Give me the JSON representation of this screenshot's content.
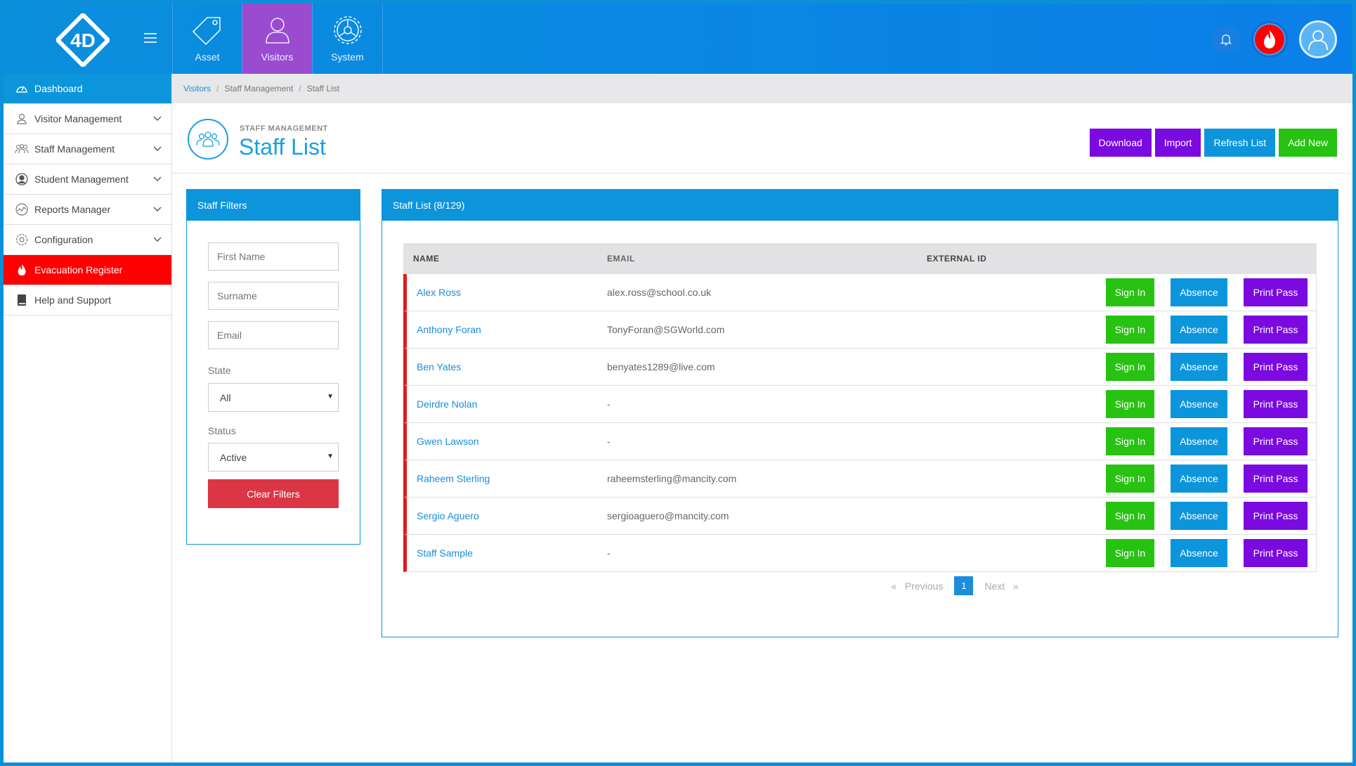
{
  "topbar": {
    "modules": [
      {
        "label": "Asset",
        "icon": "tag-icon"
      },
      {
        "label": "Visitors",
        "icon": "user-icon"
      },
      {
        "label": "System",
        "icon": "gear-icon"
      }
    ],
    "active_module": "Visitors"
  },
  "sidebar": {
    "items": [
      {
        "label": "Dashboard"
      },
      {
        "label": "Visitor Management"
      },
      {
        "label": "Staff Management"
      },
      {
        "label": "Student Management"
      },
      {
        "label": "Reports Manager"
      },
      {
        "label": "Configuration"
      },
      {
        "label": "Evacuation Register"
      },
      {
        "label": "Help and Support"
      }
    ]
  },
  "breadcrumb": {
    "items": [
      "Visitors",
      "Staff Management",
      "Staff List"
    ],
    "separator": "/"
  },
  "header": {
    "kicker": "STAFF MANAGEMENT",
    "title": "Staff List",
    "actions": [
      "Download",
      "Import",
      "Refresh List",
      "Add New"
    ]
  },
  "filters": {
    "title": "Staff Filters",
    "first_name_placeholder": "First Name",
    "surname_placeholder": "Surname",
    "email_placeholder": "Email",
    "state_label": "State",
    "state_value": "All",
    "status_label": "Status",
    "status_value": "Active",
    "clear_label": "Clear Filters"
  },
  "list": {
    "title": "Staff List (8/129)",
    "columns": [
      "NAME",
      "EMAIL",
      "EXTERNAL ID"
    ],
    "row_actions": {
      "sign_in": "Sign In",
      "absence": "Absence",
      "print": "Print Pass"
    },
    "rows": [
      {
        "name": "Alex Ross",
        "email": "alex.ross@school.co.uk",
        "external_id": ""
      },
      {
        "name": "Anthony Foran",
        "email": "TonyForan@SGWorld.com",
        "external_id": ""
      },
      {
        "name": "Ben Yates",
        "email": "benyates1289@live.com",
        "external_id": ""
      },
      {
        "name": "Deirdre Nolan",
        "email": "-",
        "external_id": ""
      },
      {
        "name": "Gwen Lawson",
        "email": "-",
        "external_id": ""
      },
      {
        "name": "Raheem Sterling",
        "email": "raheemsterling@mancity.com",
        "external_id": ""
      },
      {
        "name": "Sergio Aguero",
        "email": "sergioaguero@mancity.com",
        "external_id": ""
      },
      {
        "name": "Staff Sample",
        "email": "-",
        "external_id": ""
      }
    ]
  },
  "pagination": {
    "prev_symbol": "«",
    "prev_label": "Previous",
    "current": "1",
    "next_label": "Next",
    "next_symbol": "»"
  },
  "colors": {
    "accent": "#0d95dc",
    "active_module": "#9b4bd0",
    "evacuation": "#ff0000",
    "sign_in": "#27c212",
    "print_pass": "#7a0ae0",
    "clear": "#dc3545"
  }
}
